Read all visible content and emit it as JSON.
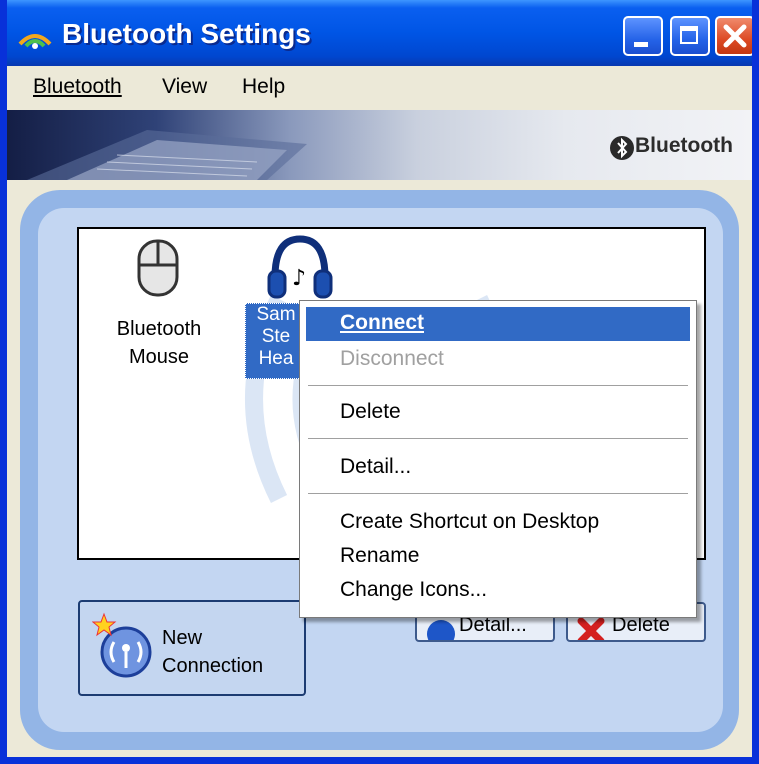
{
  "window": {
    "title": "Bluetooth Settings"
  },
  "menubar": {
    "items": [
      "Bluetooth",
      "View",
      "Help"
    ]
  },
  "banner": {
    "brand_text": "Bluetooth"
  },
  "devices": [
    {
      "label_line1": "Bluetooth",
      "label_line2": "Mouse",
      "icon": "mouse-icon"
    },
    {
      "label_line1": "Sam",
      "label_line2": "Ste",
      "label_line3": "Hea",
      "icon": "headset-icon",
      "selected": true
    }
  ],
  "buttons": {
    "new_connection_line1": "New",
    "new_connection_line2": "Connection",
    "detail": "Detail...",
    "delete": "Delete"
  },
  "context_menu": {
    "connect": "Connect",
    "disconnect": "Disconnect",
    "delete": "Delete",
    "detail": "Detail...",
    "create_shortcut": "Create Shortcut on Desktop",
    "rename": "Rename",
    "change_icons": "Change Icons..."
  },
  "colors": {
    "title_blue": "#0055e5",
    "highlight": "#316ac5",
    "panel_outer": "#93b5e6",
    "panel_inner": "#c3d6f2"
  }
}
